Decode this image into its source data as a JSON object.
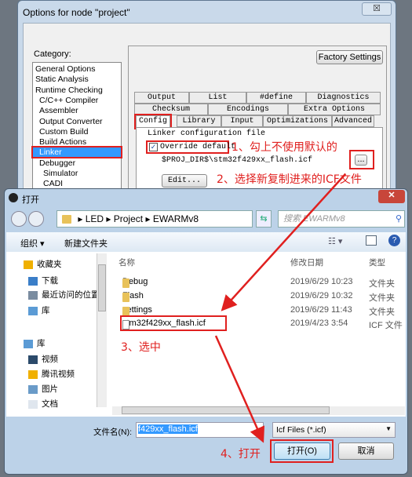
{
  "options_dialog": {
    "title": "Options for node \"project\"",
    "close": "☒",
    "category_label": "Category:",
    "categories": [
      "General Options",
      "Static Analysis",
      "Runtime Checking",
      "C/C++ Compiler",
      "Assembler",
      "Output Converter",
      "Custom Build",
      "Build Actions",
      "Linker",
      "Debugger",
      "Simulator",
      "CADI"
    ],
    "selected_category": "Linker",
    "factory_settings": "Factory Settings",
    "tabs_row1": [
      "Output",
      "List",
      "#define",
      "Diagnostics"
    ],
    "tabs_row2": [
      "Checksum",
      "Encodings",
      "Extra Options"
    ],
    "tabs_row3": [
      "Config",
      "Library",
      "Input",
      "Optimizations",
      "Advanced"
    ],
    "active_tab": "Config",
    "group_label": "Linker configuration file",
    "override_label": "Override default",
    "override_checked": true,
    "path": "$PROJ_DIR$\\stm32f429xx_flash.icf",
    "browse": "...",
    "edit": "Edit..."
  },
  "open_dialog": {
    "title": "打开",
    "breadcrumb": [
      "LED",
      "Project",
      "EWARMv8"
    ],
    "search_placeholder": "搜索 EWARMv8",
    "organize": "组织 ▾",
    "new_folder": "新建文件夹",
    "nav": [
      {
        "label": "收藏夹",
        "icon": "star-icon"
      },
      {
        "label": "下载",
        "icon": "download-icon"
      },
      {
        "label": "最近访问的位置",
        "icon": "recent-icon"
      },
      {
        "label": "库",
        "icon": "library-icon"
      },
      {
        "label": "库",
        "icon": "library-icon"
      },
      {
        "label": "视频",
        "icon": "video-icon"
      },
      {
        "label": "腾讯视频",
        "icon": "tencent-video-icon"
      },
      {
        "label": "图片",
        "icon": "picture-icon"
      },
      {
        "label": "文档",
        "icon": "document-icon"
      }
    ],
    "columns": [
      "名称",
      "修改日期",
      "类型"
    ],
    "files": [
      {
        "name": "Debug",
        "date": "2019/6/29 10:23",
        "type": "文件夹",
        "icon": "folder-icon"
      },
      {
        "name": "Flash",
        "date": "2019/6/29 10:32",
        "type": "文件夹",
        "icon": "folder-icon"
      },
      {
        "name": "settings",
        "date": "2019/6/29 11:43",
        "type": "文件夹",
        "icon": "folder-icon"
      },
      {
        "name": "stm32f429xx_flash.icf",
        "date": "2019/4/23 3:54",
        "type": "ICF 文件",
        "icon": "file-icon"
      }
    ],
    "filename_label": "文件名(N):",
    "filename_value": "f429xx_flash.icf",
    "filter": "Icf Files (*.icf)",
    "open_button": "打开(O)",
    "cancel_button": "取消"
  },
  "annotations": [
    "1、勾上不使用默认的",
    "2、选择新复制进来的ICF文件",
    "3、选中",
    "4、打开"
  ],
  "colors": {
    "annotation": "#e0201f",
    "selection": "#3399ff"
  }
}
